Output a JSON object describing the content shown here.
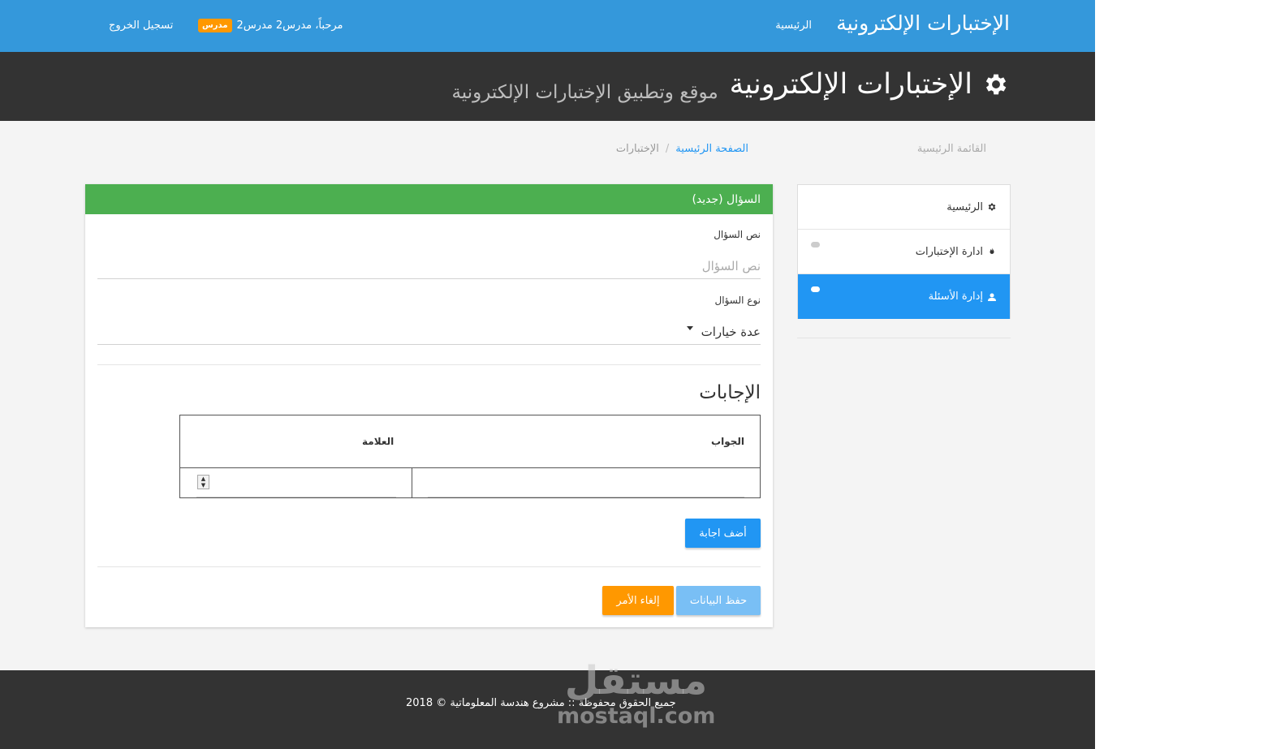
{
  "navbar": {
    "brand": "الإختبارات الإلكترونية",
    "home_link": "الرئيسية",
    "welcome_text": "مرحباً، مدرس2 مدرس2",
    "role_badge": "مدرس",
    "logout": "تسجيل الخروج"
  },
  "header": {
    "title": "الإختبارات الإلكترونية",
    "subtitle": "موقع وتطبيق الإختبارات الإلكترونية"
  },
  "sidebar": {
    "title": "القائمة الرئيسية",
    "items": [
      {
        "label": "الرئيسية",
        "icon": "gear-icon",
        "active": false
      },
      {
        "label": "ادارة الإختبارات",
        "icon": "fire-icon",
        "active": false
      },
      {
        "label": "إدارة الأسئلة",
        "icon": "user-icon",
        "active": true
      }
    ]
  },
  "breadcrumb": {
    "home": "الصفحة الرئيسية",
    "current": "الإختبارات"
  },
  "form": {
    "card_title": "السؤال (جديد)",
    "question_label": "نص السؤال",
    "question_placeholder": "نص السؤال",
    "type_label": "نوع السؤال",
    "type_value": "عدة خيارات",
    "answers_title": "الإجابات",
    "col_answer": "الجواب",
    "col_mark": "العلامة",
    "add_answer": "أضف اجابة",
    "save": "حفظ البيانات",
    "cancel": "إلغاء الأمر"
  },
  "footer": {
    "copyright": "جميع الحقوق محفوظة :: مشروع هندسة المعلوماتية © 2018"
  },
  "watermark": {
    "arabic": "مستقل",
    "latin": "mostaql.com"
  }
}
